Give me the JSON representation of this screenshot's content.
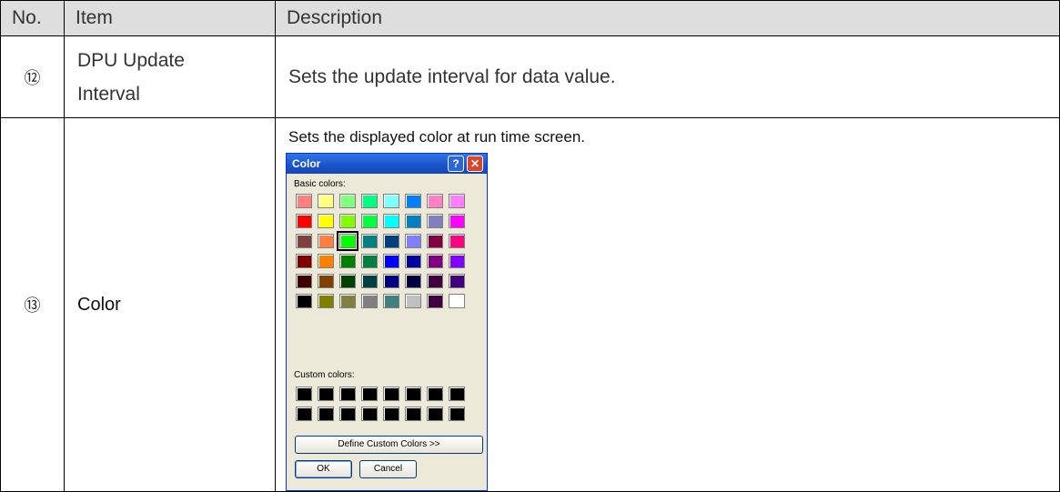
{
  "table": {
    "headers": {
      "no": "No.",
      "item": "Item",
      "description": "Description"
    },
    "rows": [
      {
        "no": "⑫",
        "item_line1": "DPU Update",
        "item_line2": "Interval",
        "description": "Sets the update interval for data value."
      },
      {
        "no": "⑬",
        "item": "Color",
        "description": "Sets the displayed color at run time screen."
      }
    ]
  },
  "dialog": {
    "title": "Color",
    "help_label": "?",
    "close_label": "✕",
    "basic_colors_label": "Basic colors:",
    "custom_colors_label": "Custom colors:",
    "define_button": "Define Custom Colors >>",
    "ok_button": "OK",
    "cancel_button": "Cancel",
    "selected_index": 18,
    "basic_colors": [
      "#ff8080",
      "#ffff80",
      "#80ff80",
      "#00ff80",
      "#80ffff",
      "#0080ff",
      "#ff80c0",
      "#ff80ff",
      "#ff0000",
      "#ffff00",
      "#80ff00",
      "#00ff40",
      "#00ffff",
      "#0080c0",
      "#8080c0",
      "#ff00ff",
      "#804040",
      "#ff8040",
      "#00ff00",
      "#008080",
      "#004080",
      "#8080ff",
      "#800040",
      "#ff0080",
      "#800000",
      "#ff8000",
      "#008000",
      "#008040",
      "#0000ff",
      "#0000a0",
      "#800080",
      "#8000ff",
      "#400000",
      "#804000",
      "#004000",
      "#004040",
      "#000080",
      "#000040",
      "#400040",
      "#400080",
      "#000000",
      "#808000",
      "#808040",
      "#808080",
      "#408080",
      "#c0c0c0",
      "#400040",
      "#ffffff"
    ],
    "custom_colors": [
      "#000000",
      "#000000",
      "#000000",
      "#000000",
      "#000000",
      "#000000",
      "#000000",
      "#000000",
      "#000000",
      "#000000",
      "#000000",
      "#000000",
      "#000000",
      "#000000",
      "#000000",
      "#000000"
    ]
  }
}
